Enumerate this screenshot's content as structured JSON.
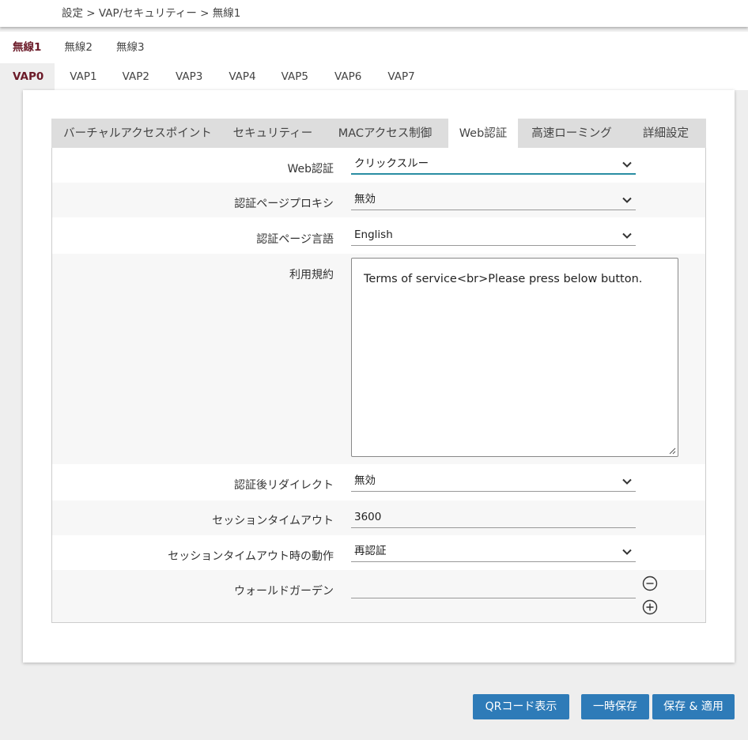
{
  "breadcrumb": "設定 > VAP/セキュリティー > 無線1",
  "wireless_tabs": [
    "無線1",
    "無線2",
    "無線3"
  ],
  "vap_tabs": [
    "VAP0",
    "VAP1",
    "VAP2",
    "VAP3",
    "VAP4",
    "VAP5",
    "VAP6",
    "VAP7"
  ],
  "sub_tabs": [
    "バーチャルアクセスポイント",
    "セキュリティー",
    "MACアクセス制御",
    "Web認証",
    "高速ローミング",
    "詳細設定"
  ],
  "form": {
    "web_auth": {
      "label": "Web認証",
      "value": "クリックスルー"
    },
    "proxy": {
      "label": "認証ページプロキシ",
      "value": "無効"
    },
    "language": {
      "label": "認証ページ言語",
      "value": "English"
    },
    "terms": {
      "label": "利用規約",
      "value": "Terms of service<br>Please press below button."
    },
    "redirect": {
      "label": "認証後リダイレクト",
      "value": "無効"
    },
    "timeout": {
      "label": "セッションタイムアウト",
      "value": "3600"
    },
    "timeout_action": {
      "label": "セッションタイムアウト時の動作",
      "value": "再認証"
    },
    "walled_garden": {
      "label": "ウォールドガーデン",
      "value": ""
    }
  },
  "buttons": {
    "qr": "QRコード表示",
    "temp_save": "一時保存",
    "save_apply": "保存 & 適用"
  },
  "colors": {
    "accent": "#2e7bb8",
    "active_tab_text": "#6b1a28",
    "focus_line": "#2a8da3"
  }
}
